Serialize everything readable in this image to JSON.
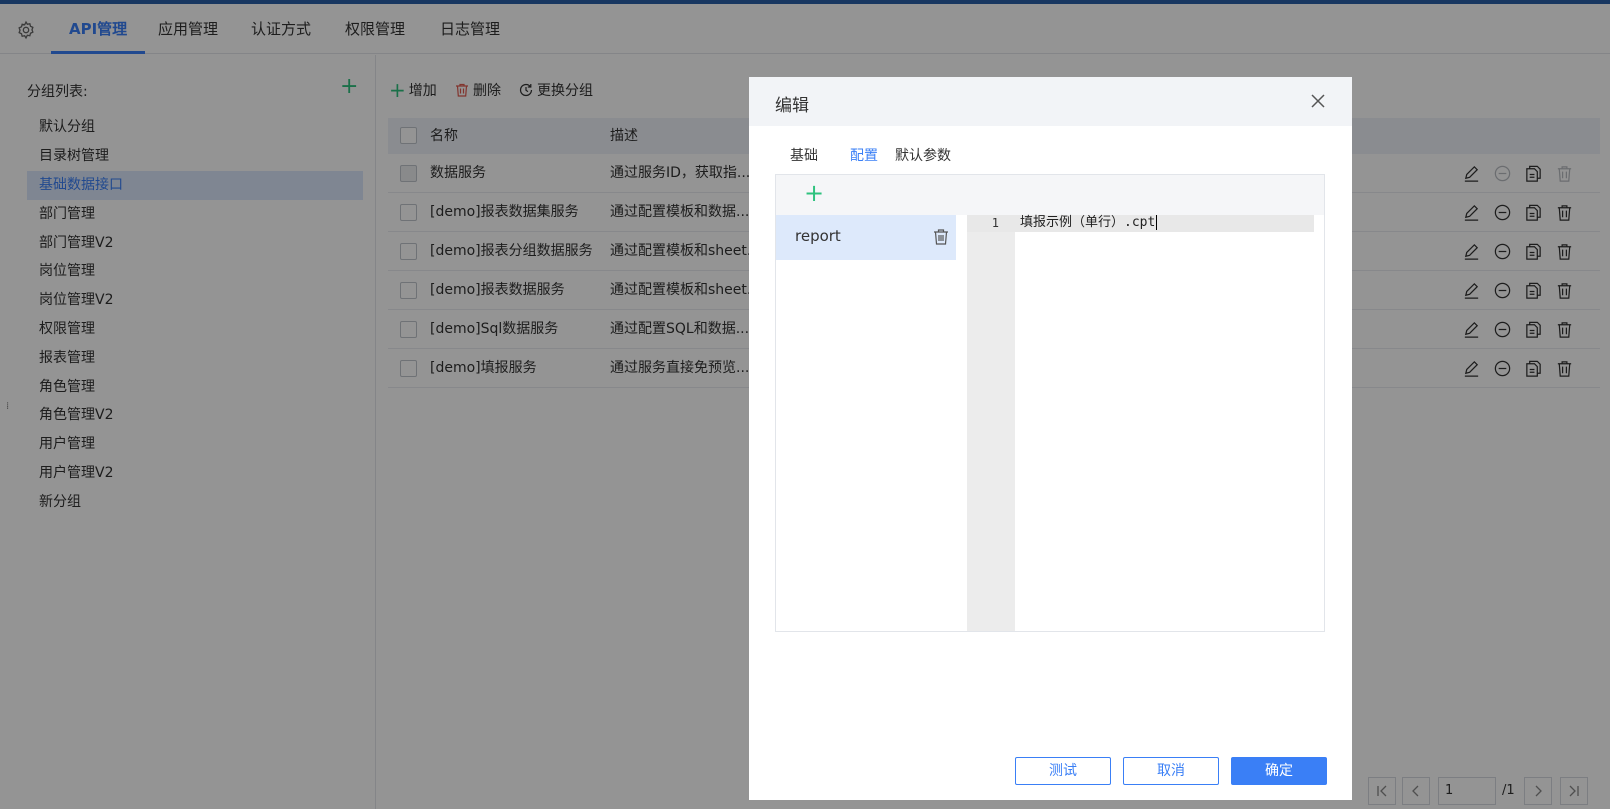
{
  "header": {
    "tabs": [
      {
        "label": "API管理",
        "active": true
      },
      {
        "label": "应用管理"
      },
      {
        "label": "认证方式"
      },
      {
        "label": "权限管理"
      },
      {
        "label": "日志管理"
      }
    ]
  },
  "groups": {
    "title": "分组列表:",
    "items": [
      "默认分组",
      "目录树管理",
      "基础数据接口",
      "部门管理",
      "部门管理V2",
      "岗位管理",
      "岗位管理V2",
      "权限管理",
      "报表管理",
      "角色管理",
      "角色管理V2",
      "用户管理",
      "用户管理V2",
      "新分组"
    ],
    "active_index": 2
  },
  "toolbar": {
    "add_label": "增加",
    "delete_label": "删除",
    "change_group_label": "更换分组"
  },
  "table": {
    "columns": [
      "名称",
      "描述"
    ],
    "rows": [
      {
        "name": "数据服务",
        "desc": "通过服务ID，获取指..."
      },
      {
        "name": "[demo]报表数据集服务",
        "desc": "通过配置模板和数据..."
      },
      {
        "name": "[demo]报表分组数据服务",
        "desc": "通过配置模板和sheet..."
      },
      {
        "name": "[demo]报表数据服务",
        "desc": "通过配置模板和sheet..."
      },
      {
        "name": "[demo]Sql数据服务",
        "desc": "通过配置SQL和数据..."
      },
      {
        "name": "[demo]填报服务",
        "desc": "通过服务直接免预览..."
      }
    ]
  },
  "pager": {
    "current": "1",
    "total": "/1"
  },
  "modal": {
    "title": "编辑",
    "tabs": [
      "基础",
      "配置",
      "默认参数"
    ],
    "active_tab": 1,
    "config_item": "report",
    "code_line_number": "1",
    "code_text": "填报示例（单行）.cpt",
    "buttons": {
      "test": "测试",
      "cancel": "取消",
      "confirm": "确定"
    }
  },
  "colors": {
    "accent": "#3a7ff6",
    "add_green": "#2ec27e",
    "topbar": "#2a5fa8"
  }
}
